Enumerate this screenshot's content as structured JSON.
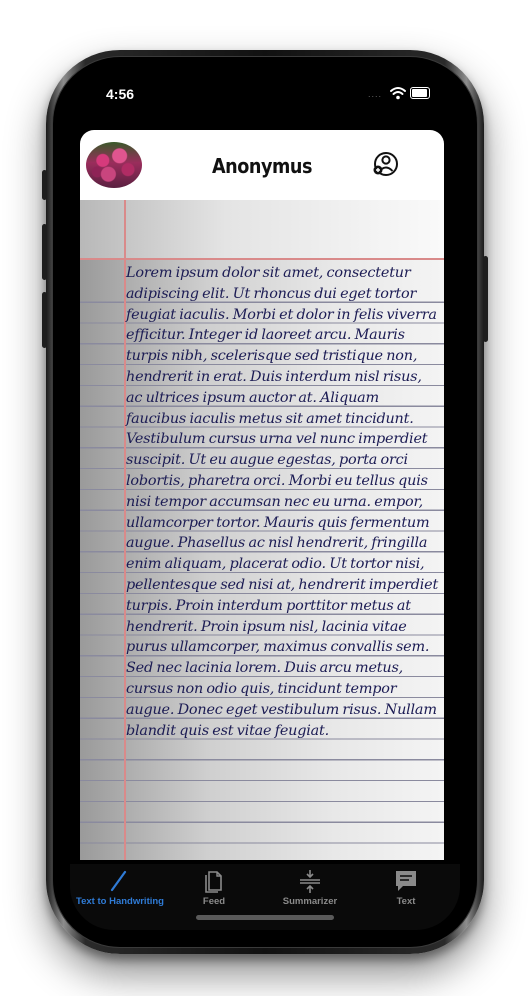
{
  "status_bar": {
    "time": "4:56"
  },
  "header": {
    "title": "Anonymus"
  },
  "handwriting_text": "Lorem ipsum dolor sit amet, consectetur adipiscing elit. Ut rhoncus dui eget tortor feugiat iaculis. Morbi et dolor in felis viverra efficitur. Integer id laoreet arcu. Mauris turpis nibh, scelerisque sed tristique non, hendrerit in erat. Duis interdum nisl risus, ac ultrices ipsum auctor at. Aliquam faucibus iaculis metus sit amet tincidunt. Vestibulum cursus urna vel nunc imperdiet suscipit. Ut eu augue egestas, porta orci lobortis, pharetra orci. Morbi eu tellus quis nisi tempor accumsan nec eu urna. empor, ullamcorper tortor. Mauris quis fermentum augue. Phasellus ac nisl hendrerit, fringilla enim aliquam, placerat odio. Ut tortor nisi, pellentesque sed nisi at, hendrerit imperdiet turpis. Proin interdum porttitor metus at hendrerit. Proin ipsum nisl, lacinia vitae purus ullamcorper, maximus convallis sem. Sed nec lacinia lorem. Duis arcu metus, cursus non odio quis, tincidunt tempor augue. Donec eget vestibulum risus. Nullam blandit quis est vitae feugiat.",
  "tabs": [
    {
      "label": "Text to Handwriting",
      "icon": "pen-icon",
      "active": true
    },
    {
      "label": "Feed",
      "icon": "documents-icon",
      "active": false
    },
    {
      "label": "Summarizer",
      "icon": "compress-icon",
      "active": false
    },
    {
      "label": "Text",
      "icon": "message-icon",
      "active": false
    }
  ],
  "colors": {
    "active_tab": "#2f7bd6",
    "inactive_tab": "#8a8a8a",
    "ink": "#1c1c54",
    "margin_rule": "#d98a8a"
  }
}
